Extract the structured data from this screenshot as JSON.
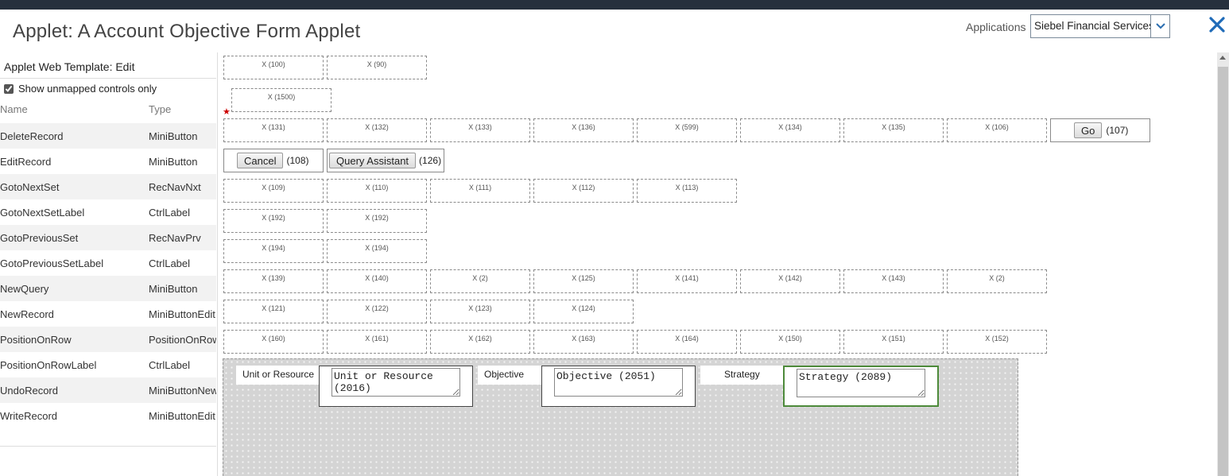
{
  "header": {
    "title": "Applet: A Account Objective Form Applet",
    "applications_label": "Applications",
    "applications_value": "Siebel Financial Services"
  },
  "left_panel": {
    "title": "Applet Web Template: Edit",
    "checkbox_label": "Show unmapped controls only",
    "checkbox_checked": true,
    "columns": {
      "name": "Name",
      "type": "Type"
    },
    "rows": [
      {
        "name": "DeleteRecord",
        "type": "MiniButton"
      },
      {
        "name": "EditRecord",
        "type": "MiniButton"
      },
      {
        "name": "GotoNextSet",
        "type": "RecNavNxt"
      },
      {
        "name": "GotoNextSetLabel",
        "type": "CtrlLabel"
      },
      {
        "name": "GotoPreviousSet",
        "type": "RecNavPrv"
      },
      {
        "name": "GotoPreviousSetLabel",
        "type": "CtrlLabel"
      },
      {
        "name": "NewQuery",
        "type": "MiniButton"
      },
      {
        "name": "NewRecord",
        "type": "MiniButtonEdit"
      },
      {
        "name": "PositionOnRow",
        "type": "PositionOnRow"
      },
      {
        "name": "PositionOnRowLabel",
        "type": "CtrlLabel"
      },
      {
        "name": "UndoRecord",
        "type": "MiniButtonNew"
      },
      {
        "name": "WriteRecord",
        "type": "MiniButtonEdit"
      }
    ]
  },
  "canvas": {
    "placeholders": {
      "r1": [
        "X (100)",
        "X (90)"
      ],
      "r2": [
        "X (1500)"
      ],
      "r3": [
        "X (131)",
        "X (132)",
        "X (133)",
        "X (136)",
        "X (599)",
        "X (134)",
        "X (135)",
        "X (106)"
      ],
      "r5": [
        "X (109)",
        "X (110)",
        "X (111)",
        "X (112)",
        "X (113)"
      ],
      "r6": [
        "X (192)",
        "X (192)"
      ],
      "r7": [
        "X (194)",
        "X (194)"
      ],
      "r8": [
        "X (139)",
        "X (140)",
        "X (2)",
        "X (125)",
        "X (141)",
        "X (142)",
        "X (143)",
        "X (2)"
      ],
      "r9": [
        "X (121)",
        "X (122)",
        "X (123)",
        "X (124)"
      ],
      "r10": [
        "X (160)",
        "X (161)",
        "X (162)",
        "X (163)",
        "X (164)",
        "X (150)",
        "X (151)",
        "X (152)"
      ]
    },
    "go_button": {
      "label": "Go",
      "id": "(107)"
    },
    "cancel_button": {
      "label": "Cancel",
      "id": "(108)"
    },
    "query_button": {
      "label": "Query Assistant",
      "id": "(126)"
    },
    "required_marker": "★",
    "form": {
      "unit_label": "Unit or Resource",
      "unit_value": "Unit or Resource (2016)",
      "objective_label": "Objective",
      "objective_value": "Objective (2051)",
      "strategy_label": "Strategy",
      "strategy_value": "Strategy (2089)"
    }
  }
}
